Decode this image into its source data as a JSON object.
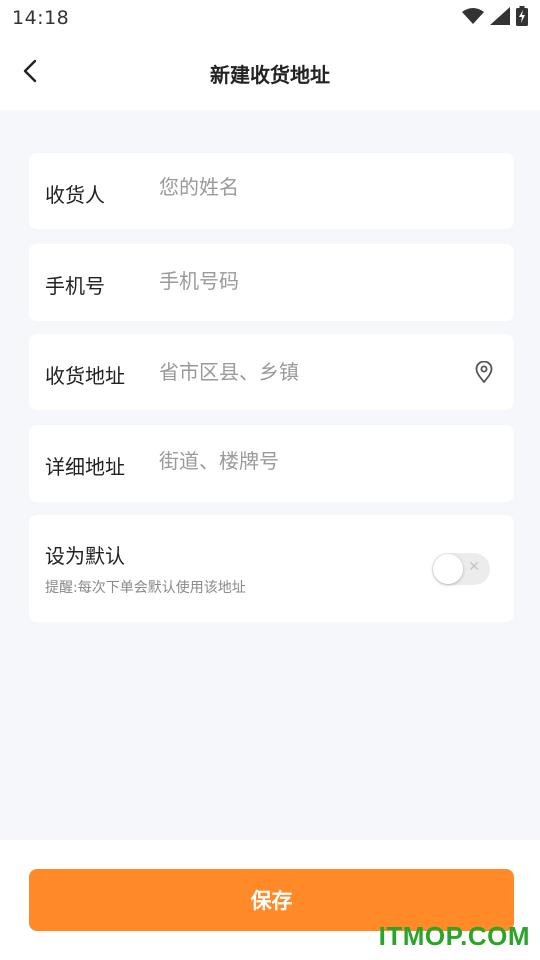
{
  "status_bar": {
    "time": "14:18",
    "icons": [
      "wifi-icon",
      "signal-icon",
      "battery-charging-icon"
    ]
  },
  "header": {
    "title": "新建收货地址",
    "back_icon": "chevron-left-icon"
  },
  "form": {
    "receiver": {
      "label": "收货人",
      "placeholder": "您的姓名",
      "value": ""
    },
    "phone": {
      "label": "手机号",
      "placeholder": "手机号码",
      "value": ""
    },
    "region": {
      "label": "收货地址",
      "placeholder": "省市区县、乡镇",
      "value": "",
      "icon": "location-pin-icon"
    },
    "detail": {
      "label": "详细地址",
      "placeholder": "街道、楼牌号",
      "value": ""
    }
  },
  "default_setting": {
    "title": "设为默认",
    "hint": "提醒:每次下单会默认使用该地址",
    "enabled": false
  },
  "actions": {
    "save_label": "保存"
  },
  "watermark": "ITMOP.COM",
  "colors": {
    "accent": "#ff8a27",
    "background": "#f6f7fb",
    "placeholder": "#9a9a9a",
    "watermark": "#2aa52a"
  }
}
